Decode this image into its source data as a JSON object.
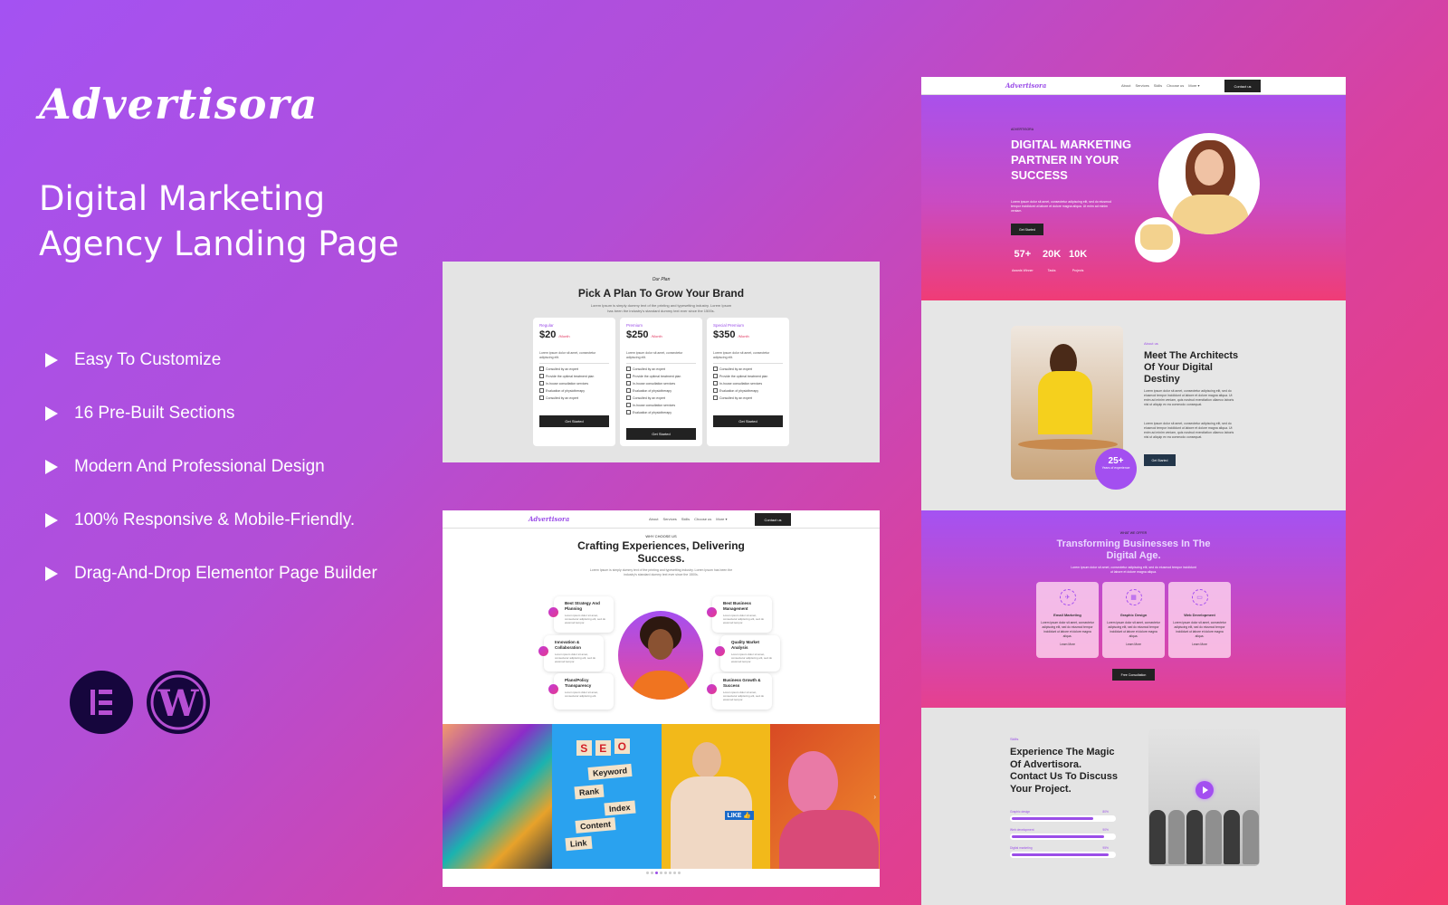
{
  "brand": "Advertisora",
  "headline": [
    "Digital Marketing",
    "Agency Landing Page"
  ],
  "features": [
    "Easy To Customize",
    "16 Pre-Built Sections",
    "Modern And Professional Design",
    "100% Responsive & Mobile-Friendly.",
    "Drag-And-Drop Elementor Page Builder"
  ],
  "platform_icons": [
    "elementor-icon",
    "wordpress-icon"
  ],
  "colors": {
    "accent": "#9b4ee8",
    "bg_start": "#a452f2",
    "bg_end": "#f23a6c",
    "dark": "#222222"
  },
  "nav": {
    "logo": "Advertisora",
    "links": [
      "About",
      "Services",
      "Skills",
      "Choose us",
      "More ▾"
    ],
    "cta": "Contact us"
  },
  "pricing": {
    "kicker": "Our Plan",
    "title": "Pick A Plan To Grow Your Brand",
    "subtitle": "Lorem Ipsum is simply dummy text of the printing and typesetting industry. Lorem Ipsum has been the industry's standard dummy text ever since the 1500s.",
    "plans": [
      {
        "name": "Regular",
        "price": "$20",
        "period": "/Month",
        "desc": "Lorem ipsum dolor sit amet, consectetur adipiscing elit.",
        "features": [
          "Consulted by an expert",
          "Provide the optimal treatment plan",
          "In-house consultation services",
          "Evaluation of physiotherapy",
          "Consulted by an expert"
        ],
        "button": "Get Started"
      },
      {
        "name": "Premium",
        "price": "$250",
        "period": "/Month",
        "desc": "Lorem ipsum dolor sit amet, consectetur adipiscing elit.",
        "features": [
          "Consulted by an expert",
          "Provide the optimal treatment plan",
          "In-house consultation services",
          "Evaluation of physiotherapy",
          "Consulted by an expert",
          "In-house consultation services",
          "Evaluation of physiotherapy"
        ],
        "button": "Get Started"
      },
      {
        "name": "Special Premium",
        "price": "$350",
        "period": "/Month",
        "desc": "Lorem ipsum dolor sit amet, consectetur adipiscing elit.",
        "features": [
          "Consulted by an expert",
          "Provide the optimal treatment plan",
          "In-house consultation services",
          "Evaluation of physiotherapy",
          "Consulted by an expert"
        ],
        "button": "Get Started"
      }
    ]
  },
  "choose": {
    "kicker": "WHY CHOOSE US",
    "title": "Crafting Experiences, Delivering Success.",
    "subtitle": "Lorem Ipsum is simply dummy text of the printing and typesetting industry. Lorem Ipsum has been the industry's standard dummy text ever since the 1500s.",
    "cards": [
      {
        "title": "Best Strategy And Planning",
        "desc": "Lorem ipsum dolor sit amet, consectetur adipiscing elit, sed do eiusmod tempor."
      },
      {
        "title": "Innovation & Collaboration",
        "desc": "Lorem ipsum dolor sit amet, consectetur adipiscing elit, sed do eiusmod tempor."
      },
      {
        "title": "Plans/Policy Transparency",
        "desc": "Lorem ipsum dolor sit amet, consectetur adipiscing elit."
      },
      {
        "title": "Best Business Management",
        "desc": "Lorem ipsum dolor sit amet, consectetur adipiscing elit, sed do eiusmod tempor."
      },
      {
        "title": "Quality Market Analysis",
        "desc": "Lorem ipsum dolor sit amet, consectetur adipiscing elit, sed do eiusmod tempor."
      },
      {
        "title": "Business Growth & Success",
        "desc": "Lorem ipsum dolor sit amet, consectetur adipiscing elit, sed do eiusmod tempor."
      }
    ],
    "gallery_words": {
      "seo": [
        "S",
        "E",
        "O"
      ],
      "blocks": [
        "Keyword",
        "Rank",
        "Index",
        "Content",
        "Link"
      ],
      "like": "LIKE 👍"
    },
    "slider_dots": 8,
    "active_dot": 2
  },
  "hero": {
    "kicker": "ADVERTISORA",
    "title": "DIGITAL MARKETING PARTNER IN YOUR SUCCESS",
    "desc": "Lorem ipsum dolor sit amet, consectetur adipiscing elit, sed do eiusmod tempor incididunt ut labore et dolore magna aliqua. Ut enim ad minim veniam.",
    "button": "Get Started",
    "stats": [
      {
        "value": "57+",
        "label": "Awards Winner"
      },
      {
        "value": "20K",
        "label": "Tasks"
      },
      {
        "value": "10K",
        "label": "Projects"
      }
    ]
  },
  "about": {
    "kicker": "About us",
    "title": "Meet The Architects Of Your Digital Destiny",
    "para1": "Lorem ipsum dolor sit amet, consectetur adipiscing elit, sed do eiusmod tempor incididunt ut labore et dolore magna aliqua. Ut enim ad minim veniam, quis nostrud exercitation ullamco laboris nisi ut aliquip ex ea commodo consequat.",
    "para2": "Lorem ipsum dolor sit amet, consectetur adipiscing elit, sed do eiusmod tempor incididunt ut labore et dolore magna aliqua. Ut enim ad minim veniam, quis nostrud exercitation ullamco laboris nisi ut aliquip ex ea commodo consequat.",
    "button": "Get Started",
    "badge_value": "25+",
    "badge_label": "Years of experience"
  },
  "offer": {
    "kicker": "WHAT WE OFFER",
    "title": "Transforming Businesses In The Digital Age.",
    "subtitle": "Lorem ipsum dolor sit amet, consectetur adipiscing elit, sed do eiusmod tempor incididunt ut labore et dolore magna aliqua.",
    "cards": [
      {
        "icon": "✈",
        "name": "Email Marketing",
        "desc": "Lorem ipsum dolor sit amet, consectetur adipiscing elit, sed do eiusmod tempor incididunt ut labore et dolore magna aliqua.",
        "link": "Learn More"
      },
      {
        "icon": "▦",
        "name": "Graphic Design",
        "desc": "Lorem ipsum dolor sit amet, consectetur adipiscing elit, sed do eiusmod tempor incididunt ut labore et dolore magna aliqua.",
        "link": "Learn More"
      },
      {
        "icon": "▭",
        "name": "Web Development",
        "desc": "Lorem ipsum dolor sit amet, consectetur adipiscing elit, sed do eiusmod tempor incididunt ut labore et dolore magna aliqua.",
        "link": "Learn More"
      }
    ],
    "button": "Free Consultation"
  },
  "skills": {
    "kicker": "Skills",
    "title": "Experience The Magic Of Advertisora. Contact Us To Discuss Your Project.",
    "bars": [
      {
        "label": "Graphic design",
        "percent": 80
      },
      {
        "label": "Web development",
        "percent": 90
      },
      {
        "label": "Digital marketing",
        "percent": 95
      }
    ]
  }
}
